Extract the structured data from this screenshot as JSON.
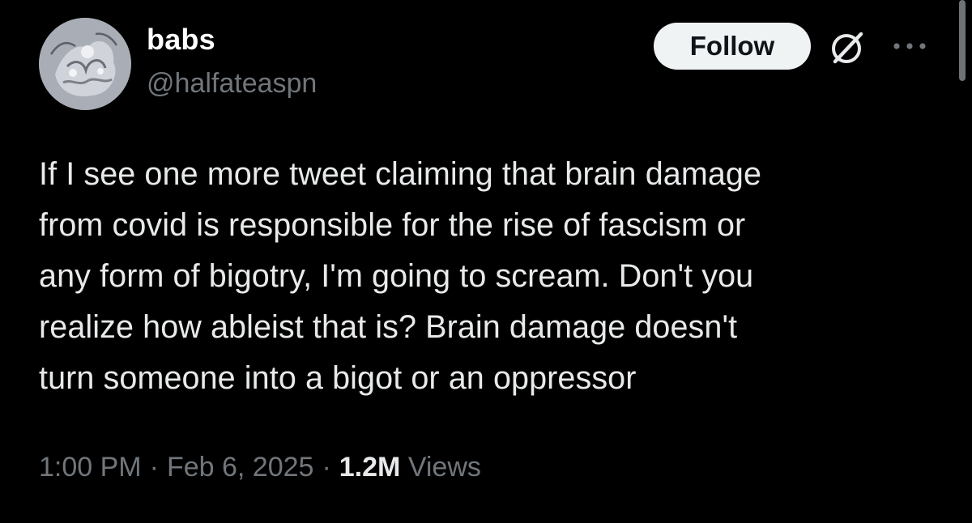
{
  "author": {
    "display_name": "babs",
    "handle": "@halfateaspn",
    "avatar_icon": "ornate-statue-avatar"
  },
  "actions": {
    "follow_label": "Follow",
    "grok_icon": "grok-icon",
    "more_icon": "more-icon"
  },
  "tweet": {
    "text": "If I see one more tweet claiming that brain damage\nfrom covid is responsible for the rise of fascism or\nany form of bigotry, I'm going to scream. Don't you\nrealize how ableist that is? Brain damage doesn't\nturn someone into a bigot or an oppressor"
  },
  "meta": {
    "time": "1:00 PM",
    "separator": "·",
    "date": "Feb 6, 2025",
    "views_count": "1.2M",
    "views_label": "Views"
  },
  "colors": {
    "background": "#000000",
    "primary_text": "#e7e9ea",
    "secondary_text": "#71767b",
    "follow_bg": "#eff3f4"
  }
}
